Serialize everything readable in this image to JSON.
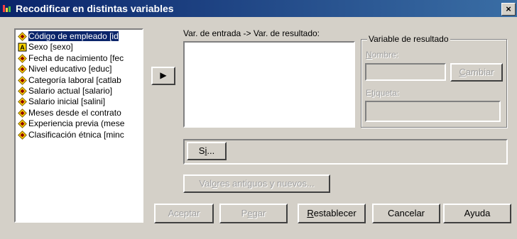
{
  "window": {
    "title": "Recodificar en distintas variables",
    "close": "×"
  },
  "variables": [
    {
      "label": "Código de empleado [id",
      "icon": "scale-icon",
      "selected": true
    },
    {
      "label": "Sexo [sexo]",
      "icon": "string-icon",
      "selected": false
    },
    {
      "label": "Fecha de nacimiento [fec",
      "icon": "scale-icon",
      "selected": false
    },
    {
      "label": "Nivel educativo [educ]",
      "icon": "scale-icon",
      "selected": false
    },
    {
      "label": "Categoría laboral [catlab",
      "icon": "scale-icon",
      "selected": false
    },
    {
      "label": "Salario actual [salario]",
      "icon": "scale-icon",
      "selected": false
    },
    {
      "label": "Salario inicial [salini]",
      "icon": "scale-icon",
      "selected": false
    },
    {
      "label": "Meses desde el contrato",
      "icon": "scale-icon",
      "selected": false
    },
    {
      "label": "Experiencia previa (mese",
      "icon": "scale-icon",
      "selected": false
    },
    {
      "label": "Clasificación étnica [minc",
      "icon": "scale-icon",
      "selected": false
    }
  ],
  "input_output": {
    "label": "Var. de entrada -> Var. de resultado:"
  },
  "result_group": {
    "title": "Variable de resultado",
    "name_label": "Nombre:",
    "name_value": "",
    "change_button": "Cambiar",
    "label_label": "Etiqueta:",
    "label_value": ""
  },
  "buttons": {
    "move": "▶",
    "si": "Si...",
    "old_new": "Valores antiguos y nuevos...",
    "accept": "Aceptar",
    "paste": "Pegar",
    "reset": "Restablecer",
    "cancel": "Cancelar",
    "help": "Ayuda"
  }
}
